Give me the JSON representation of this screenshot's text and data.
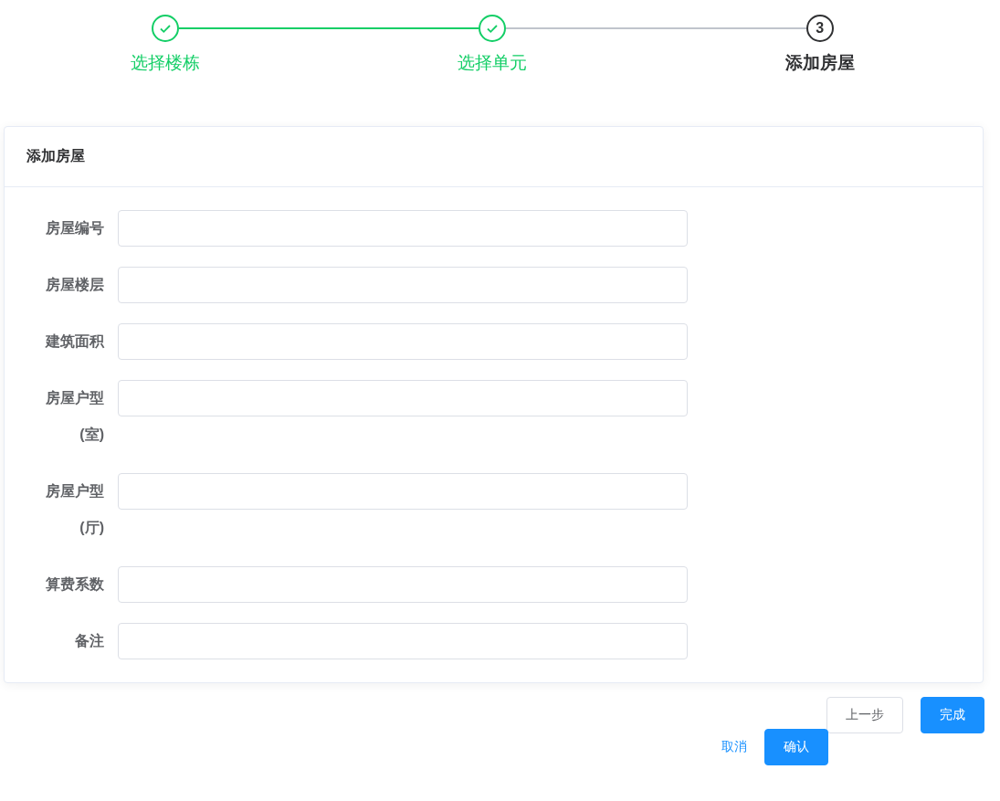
{
  "steps": [
    {
      "label": "选择楼栋",
      "finished": true
    },
    {
      "label": "选择单元",
      "finished": true
    },
    {
      "label": "添加房屋",
      "finished": false,
      "number": "3"
    }
  ],
  "card": {
    "title": "添加房屋",
    "fields": [
      {
        "label": "房屋编号"
      },
      {
        "label": "房屋楼层"
      },
      {
        "label": "建筑面积"
      },
      {
        "label": "房屋户型(室)"
      },
      {
        "label": "房屋户型(厅)"
      },
      {
        "label": "算费系数"
      },
      {
        "label": "备注"
      }
    ]
  },
  "step_buttons": [
    {
      "label": "上一步",
      "kind": "plain"
    },
    {
      "label": "完成",
      "kind": "primary"
    }
  ],
  "dialog_buttons": [
    {
      "label": "取消",
      "kind": "text"
    },
    {
      "label": "确认",
      "kind": "primary"
    }
  ]
}
